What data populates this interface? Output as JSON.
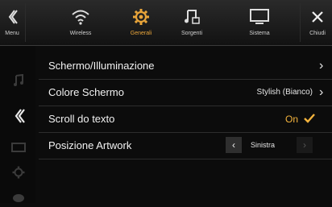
{
  "topbar": {
    "items": [
      {
        "label": "Menu",
        "icon": "back-chevron-icon"
      },
      {
        "label": "Wireless",
        "icon": "wifi-icon"
      },
      {
        "label": "Generali",
        "icon": "gear-icon"
      },
      {
        "label": "Sorgenti",
        "icon": "music-note-icon"
      },
      {
        "label": "Sistema",
        "icon": "monitor-icon"
      },
      {
        "label": "Chiudi",
        "icon": "close-icon"
      }
    ]
  },
  "sidebar": {
    "icons": [
      "music-note-icon",
      "back-chevron-icon",
      "monitor-icon",
      "gear-icon",
      "disc-icon"
    ]
  },
  "settings": {
    "rows": [
      {
        "label": "Schermo/Illuminazione"
      },
      {
        "label": "Colore Schermo",
        "value": "Stylish (Bianco)"
      },
      {
        "label": "Scroll do texto",
        "value": "On"
      },
      {
        "label": "Posizione Artwork",
        "value": "Sinistra"
      }
    ]
  },
  "colors": {
    "accent": "#e9a53a",
    "check": "#f3b33d"
  }
}
